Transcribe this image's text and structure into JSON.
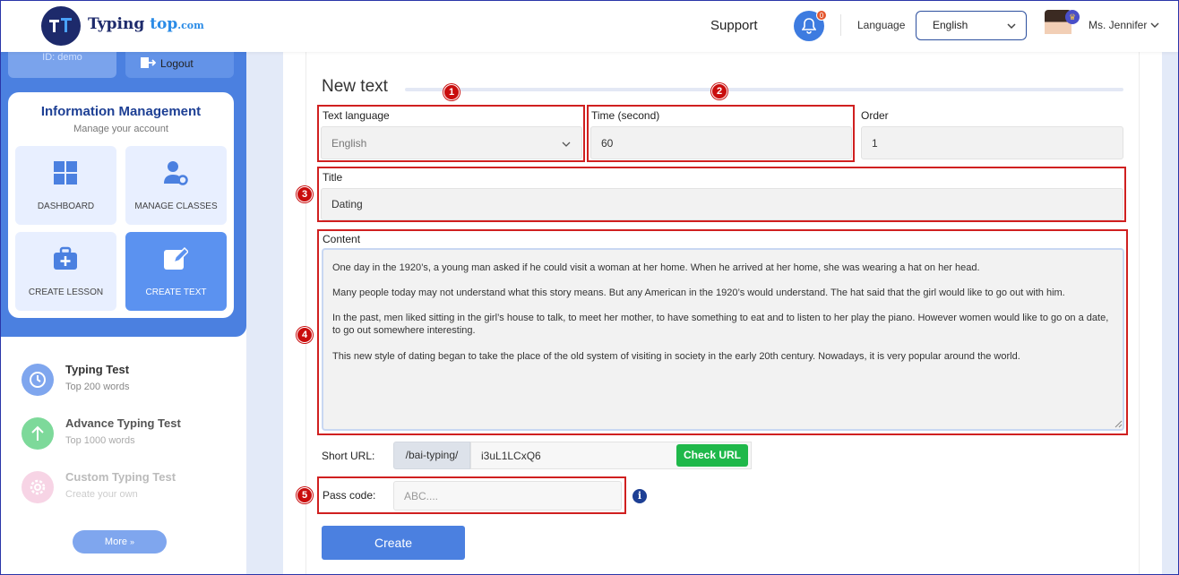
{
  "header": {
    "logo_text_1": "Typing",
    "logo_text_2": "top",
    "logo_text_3": ".com",
    "support": "Support",
    "notification_count": "0",
    "language_label": "Language",
    "language_value": "English",
    "user_name": "Ms. Jennifer"
  },
  "sidebar": {
    "id_label": "ID: demo",
    "logout": "Logout",
    "info_title": "Information Management",
    "info_subtitle": "Manage your account",
    "tiles": [
      {
        "label": "DASHBOARD",
        "icon": "grid-icon"
      },
      {
        "label": "MANAGE CLASSES",
        "icon": "user-gear-icon"
      },
      {
        "label": "CREATE LESSON",
        "icon": "briefcase-plus-icon"
      },
      {
        "label": "CREATE TEXT",
        "icon": "edit-icon"
      }
    ],
    "nav": [
      {
        "title": "Typing Test",
        "subtitle": "Top 200 words",
        "color": "#7fa6ee"
      },
      {
        "title": "Advance Typing Test",
        "subtitle": "Top 1000 words",
        "color": "#7dd99a"
      },
      {
        "title": "Custom Typing Test",
        "subtitle": "Create your own",
        "color": "#f2b8d6"
      }
    ],
    "more": "More"
  },
  "form": {
    "heading": "New text",
    "text_language_label": "Text language",
    "text_language_value": "English",
    "time_label": "Time (second)",
    "time_value": "60",
    "order_label": "Order",
    "order_value": "1",
    "title_label": "Title",
    "title_value": "Dating",
    "content_label": "Content",
    "content_paragraphs": [
      "One day in the 1920’s, a young man asked if he could visit a woman at her home. When he arrived at her home, she was wearing a hat on her head.",
      "Many people today may not understand what this story means. But any American in the 1920’s would understand. The hat said that the girl would like to go out with him.",
      "In the past, men liked sitting in the girl’s house to talk, to meet her mother, to have something to eat and to listen to her play the piano. However women would like to go on a date, to go out somewhere interesting.",
      "This new style of dating began to take the place of the old system of visiting in society in the early 20th century. Nowadays, it is very popular around the world."
    ],
    "short_url_label": "Short URL:",
    "short_url_prefix": "/bai-typing/",
    "short_url_value": "i3uL1LCxQ6",
    "check_url": "Check URL",
    "pass_code_label": "Pass code:",
    "pass_code_placeholder": "ABC....",
    "create": "Create"
  },
  "annotations": [
    "1",
    "2",
    "3",
    "4",
    "5"
  ],
  "colors": {
    "primary": "#4b80e0",
    "dark_navy": "#1d3f94",
    "highlight_red": "#d02020",
    "success_green": "#1fb84a"
  }
}
